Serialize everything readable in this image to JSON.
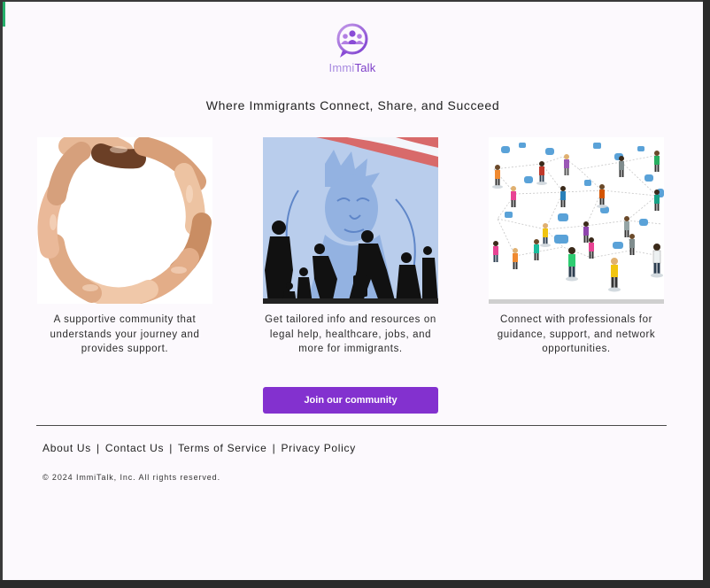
{
  "brand": {
    "name_part1": "Immi",
    "name_part2": "Talk",
    "logo_icon": "people-speech-bubble-icon",
    "primary_color": "#8331cf",
    "logo_color": "#a166e0"
  },
  "hero": {
    "tagline": "Where Immigrants Connect, Share, and Succeed"
  },
  "features": [
    {
      "image": "hands-circle-image",
      "text": "A supportive community that understands your journey and provides support."
    },
    {
      "image": "statue-of-liberty-silhouettes-image",
      "text": "Get tailored info and resources on legal help, healthcare, jobs, and more for immigrants."
    },
    {
      "image": "people-network-image",
      "text": "Connect with professionals for guidance, support, and network opportunities."
    }
  ],
  "cta": {
    "label": "Join our community"
  },
  "footer": {
    "links": [
      "About Us",
      "Contact Us",
      "Terms of Service",
      "Privacy Policy"
    ],
    "separator": "|",
    "copyright": "© 2024 ImmiTalk, Inc. All rights reserved."
  }
}
